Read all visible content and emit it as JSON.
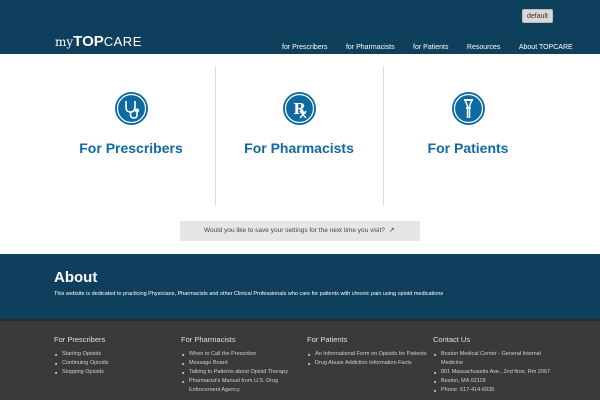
{
  "header": {
    "style_button": "default",
    "logo": {
      "pre": "my",
      "mid": "TOP",
      "post": "CARE"
    },
    "nav": [
      "for Prescribers",
      "for Pharmacists",
      "for Patients",
      "Resources",
      "About TOPCARE"
    ]
  },
  "panels": [
    {
      "title": "For Prescribers",
      "icon": "stethoscope-icon"
    },
    {
      "title": "For Pharmacists",
      "icon": "rx-icon"
    },
    {
      "title": "For Patients",
      "icon": "crutch-icon"
    }
  ],
  "save_settings": {
    "text": "Would you like to save your settings for the next time you visit?"
  },
  "about": {
    "title": "About",
    "text": "This website is dedicated to practicing Physicians, Pharmacists and other Clinical Professionals who care for patients with chronic pain using opioid medications"
  },
  "footer": {
    "columns": [
      {
        "title": "For Prescribers",
        "items": [
          "Starting Opioids",
          "Continuing Opioids",
          "Stopping Opioids"
        ]
      },
      {
        "title": "For Pharmacists",
        "items": [
          "When to Call the Prescriber",
          "Message Board",
          "Talking to Patients about Opioid Therapy",
          "Pharmacist's Manual from U.S. Drug Enforcement Agency"
        ]
      },
      {
        "title": "For Patients",
        "items": [
          "An Informational Form on Opioids for Patients",
          "Drug Abuse Addiction Information Facts"
        ]
      },
      {
        "title": "Contact Us",
        "items": [
          "Boston Medical Center - General Internal Medicine",
          "801 Massachusetts Ave., 2nd floor, Rm 2067",
          "Boston, MA 02118",
          "Phone: 617-414-6938"
        ]
      }
    ]
  },
  "colors": {
    "header_bg": "#0e3f5c",
    "accent": "#0f6aa0",
    "footer_bg": "#3a3a3a"
  }
}
